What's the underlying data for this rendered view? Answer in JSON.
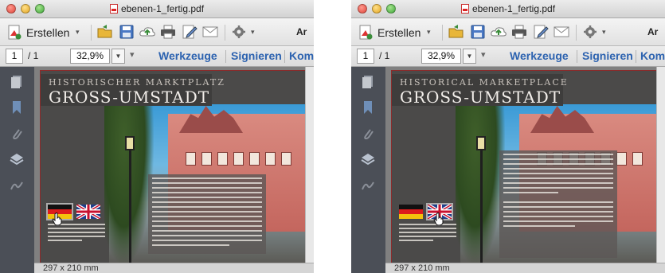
{
  "windows": [
    {
      "id": "left",
      "title": "ebenen-1_fertig.pdf",
      "toolbar": {
        "create_label": "Erstellen",
        "more_label": "Ar"
      },
      "nav": {
        "page_current": "1",
        "page_total": "/ 1",
        "zoom": "32,9%",
        "links": [
          "Werkzeuge",
          "Signieren",
          "Komm"
        ]
      },
      "doc": {
        "header_small": "HISTORISCHER MARKTPLATZ",
        "header_big": "GROSS-UMSTADT",
        "selected_language": "de"
      },
      "status": {
        "page_size": "297 x 210 mm"
      }
    },
    {
      "id": "right",
      "title": "ebenen-1_fertig.pdf",
      "toolbar": {
        "create_label": "Erstellen",
        "more_label": "Ar"
      },
      "nav": {
        "page_current": "1",
        "page_total": "/ 1",
        "zoom": "32,9%",
        "links": [
          "Werkzeuge",
          "Signieren",
          "Komm"
        ]
      },
      "doc": {
        "header_small": "HISTORICAL MARKETPLACE",
        "header_big": "GROSS-UMSTADT",
        "selected_language": "en"
      },
      "status": {
        "page_size": "297 x 210 mm"
      }
    }
  ],
  "icons": [
    "create-pdf-icon",
    "open-folder-icon",
    "save-icon",
    "cloud-upload-icon",
    "print-icon",
    "edit-sign-icon",
    "mail-icon",
    "gear-icon",
    "pages-panel-icon",
    "bookmark-icon",
    "attachment-icon",
    "layers-icon",
    "signatures-icon",
    "german-flag-icon",
    "uk-flag-icon",
    "hand-cursor-icon"
  ],
  "colors": {
    "link": "#2d63b0",
    "sidebar": "#4b4f57",
    "canvas": "#808080",
    "page": "#4b4a49"
  }
}
